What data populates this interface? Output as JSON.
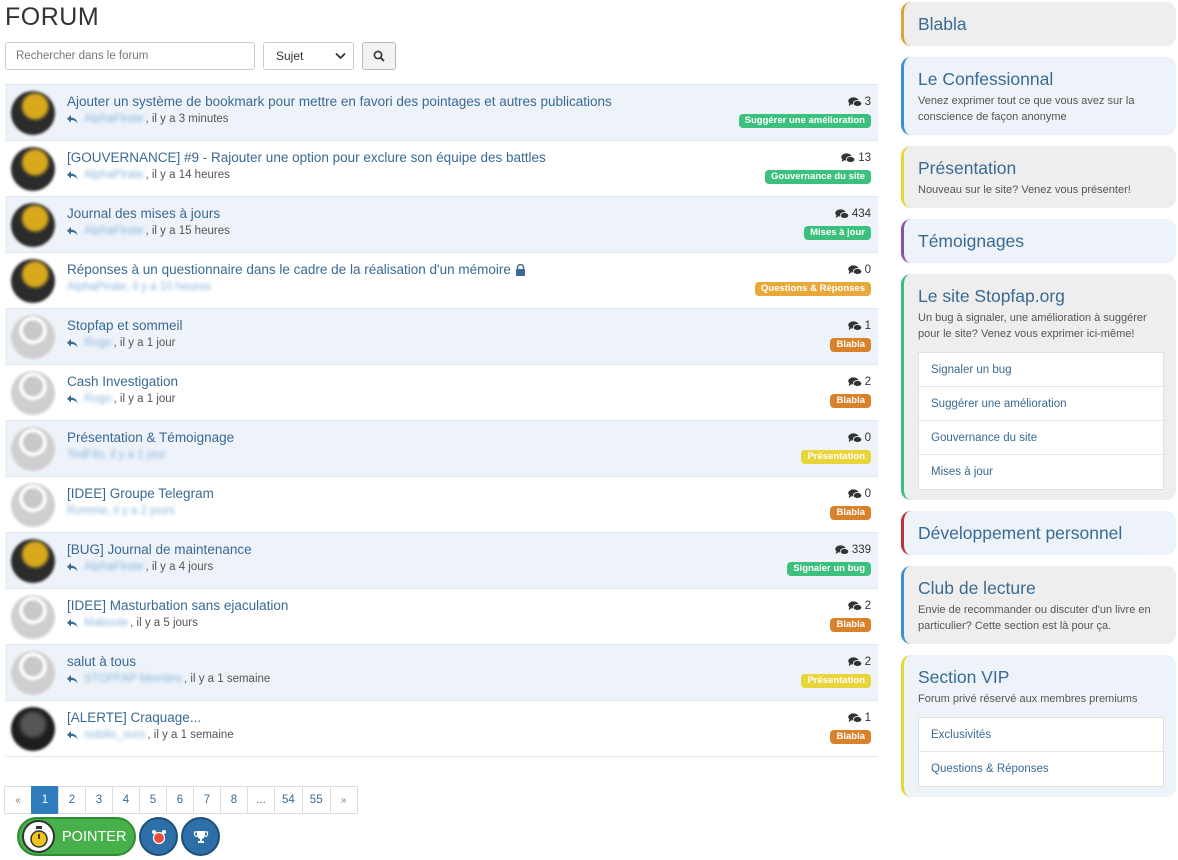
{
  "header": {
    "title": "FORUM"
  },
  "search": {
    "placeholder": "Rechercher dans le forum",
    "select_value": "Sujet"
  },
  "topics": [
    {
      "title": "Ajouter un système de bookmark pour mettre en favori des pointages et autres publications",
      "author": "AlphaPirate",
      "time": ", il y a 3 minutes",
      "count": "3",
      "badge": "Suggérer une amélioration",
      "badge_color": "#3dbf7e",
      "avatar": "yellow",
      "locked": false
    },
    {
      "title": "[GOUVERNANCE] #9 - Rajouter une option pour exclure son équipe des battles",
      "author": "AlphaPirate",
      "time": ", il y a 14 heures",
      "count": "13",
      "badge": "Gouvernance du site",
      "badge_color": "#3dbf7e",
      "avatar": "yellow",
      "locked": false
    },
    {
      "title": "Journal des mises à jours",
      "author": "AlphaPirate",
      "time": ", il y a 15 heures",
      "count": "434",
      "badge": "Mises à jour",
      "badge_color": "#3dbf7e",
      "avatar": "yellow",
      "locked": false
    },
    {
      "title": "Réponses à un questionnaire dans le cadre de la réalisation d'un mémoire",
      "author": "AlphaPirate, il y a 10 heures",
      "time": "",
      "count": "0",
      "badge": "Questions & Réponses",
      "badge_color": "#e8a93a",
      "avatar": "yellow",
      "locked": true,
      "no_reply_icon": true
    },
    {
      "title": "Stopfap et sommeil",
      "author": "Rogo",
      "time": ", il y a 1 jour",
      "count": "1",
      "badge": "Blabla",
      "badge_color": "#d9822b",
      "avatar": "grey",
      "locked": false
    },
    {
      "title": "Cash Investigation",
      "author": "Rogo",
      "time": ", il y a 1 jour",
      "count": "2",
      "badge": "Blabla",
      "badge_color": "#d9822b",
      "avatar": "grey",
      "locked": false
    },
    {
      "title": "Présentation & Témoignage",
      "author": "TedFilo, il y a 1 jour",
      "time": "",
      "count": "0",
      "badge": "Présentation",
      "badge_color": "#e9d43a",
      "avatar": "grey",
      "locked": false,
      "no_reply_icon": true
    },
    {
      "title": "[IDEE] Groupe Telegram",
      "author": "Romme, il y a 2 jours",
      "time": "",
      "count": "0",
      "badge": "Blabla",
      "badge_color": "#d9822b",
      "avatar": "grey",
      "locked": false,
      "no_reply_icon": true
    },
    {
      "title": "[BUG] Journal de maintenance",
      "author": "AlphaPirate",
      "time": ", il y a 4 jours",
      "count": "339",
      "badge": "Signaler un bug",
      "badge_color": "#3dbf7e",
      "avatar": "yellow",
      "locked": false
    },
    {
      "title": "[IDEE] Masturbation sans ejaculation",
      "author": "Maboule",
      "time": ", il y a 5 jours",
      "count": "2",
      "badge": "Blabla",
      "badge_color": "#d9822b",
      "avatar": "grey",
      "locked": false
    },
    {
      "title": "salut à tous",
      "author": "STOPFAP Membre",
      "time": ", il y a 1 semaine",
      "count": "2",
      "badge": "Présentation",
      "badge_color": "#e9d43a",
      "avatar": "grey",
      "locked": false
    },
    {
      "title": "[ALERTE] Craquage...",
      "author": "nobilis_ours",
      "time": ", il y a 1 semaine",
      "count": "1",
      "badge": "Blabla",
      "badge_color": "#d9822b",
      "avatar": "dark",
      "locked": false
    }
  ],
  "pagination": [
    "«",
    "1",
    "2",
    "3",
    "4",
    "5",
    "6",
    "7",
    "8",
    "...",
    "54",
    "55",
    "»"
  ],
  "pagination_active": "1",
  "bottom": {
    "pointer_label": "POINTER"
  },
  "categories": [
    {
      "title": "Blabla",
      "desc": "",
      "border": "#e0a33a",
      "sub": []
    },
    {
      "title": "Le Confessionnal",
      "desc": "Venez exprimer tout ce que vous avez sur la conscience de façon anonyme",
      "border": "#3d8fd1",
      "sub": []
    },
    {
      "title": "Présentation",
      "desc": "Nouveau sur le site? Venez vous présenter!",
      "border": "#e9d43a",
      "sub": []
    },
    {
      "title": "Témoignages",
      "desc": "",
      "border": "#8b4fb3",
      "sub": []
    },
    {
      "title": "Le site Stopfap.org",
      "desc": "Un bug à signaler, une amélioration à suggérer pour le site? Venez vous exprimer ici-même!",
      "border": "#3dbf7e",
      "sub": [
        "Signaler un bug",
        "Suggérer une amélioration",
        "Gouvernance du site",
        "Mises à jour"
      ]
    },
    {
      "title": "Développement personnel",
      "desc": "",
      "border": "#b8333a",
      "sub": []
    },
    {
      "title": "Club de lecture",
      "desc": "Envie de recommander ou discuter d'un livre en particulier? Cette section est là pour ça.",
      "border": "#3d8fd1",
      "sub": []
    },
    {
      "title": "Section VIP",
      "desc": "Forum privé réservé aux membres premiums",
      "border": "#e9d43a",
      "sub": [
        "Exclusivités",
        "Questions & Réponses"
      ]
    }
  ]
}
